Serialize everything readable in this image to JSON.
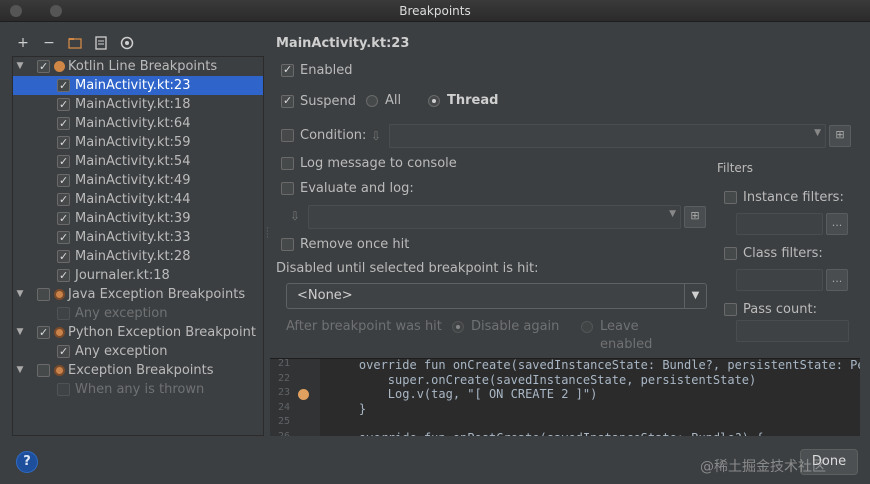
{
  "window": {
    "title": "Breakpoints"
  },
  "toolbar": {
    "add": "+",
    "remove": "−"
  },
  "tree": [
    {
      "id": "kotlin",
      "label": "Kotlin Line Breakpoints",
      "level": 0,
      "arrow": "▼",
      "checked": true,
      "icon": "dot",
      "disabled": false,
      "selected": false
    },
    {
      "id": "k1",
      "label": "MainActivity.kt:23",
      "level": 1,
      "checked": true,
      "selected": true,
      "disabled": false
    },
    {
      "id": "k2",
      "label": "MainActivity.kt:18",
      "level": 1,
      "checked": true,
      "selected": false,
      "disabled": false
    },
    {
      "id": "k3",
      "label": "MainActivity.kt:64",
      "level": 1,
      "checked": true,
      "selected": false,
      "disabled": false
    },
    {
      "id": "k4",
      "label": "MainActivity.kt:59",
      "level": 1,
      "checked": true,
      "selected": false,
      "disabled": false
    },
    {
      "id": "k5",
      "label": "MainActivity.kt:54",
      "level": 1,
      "checked": true,
      "selected": false,
      "disabled": false
    },
    {
      "id": "k6",
      "label": "MainActivity.kt:49",
      "level": 1,
      "checked": true,
      "selected": false,
      "disabled": false
    },
    {
      "id": "k7",
      "label": "MainActivity.kt:44",
      "level": 1,
      "checked": true,
      "selected": false,
      "disabled": false
    },
    {
      "id": "k8",
      "label": "MainActivity.kt:39",
      "level": 1,
      "checked": true,
      "selected": false,
      "disabled": false
    },
    {
      "id": "k9",
      "label": "MainActivity.kt:33",
      "level": 1,
      "checked": true,
      "selected": false,
      "disabled": false
    },
    {
      "id": "k10",
      "label": "MainActivity.kt:28",
      "level": 1,
      "checked": true,
      "selected": false,
      "disabled": false
    },
    {
      "id": "k11",
      "label": "Journaler.kt:18",
      "level": 1,
      "checked": true,
      "selected": false,
      "disabled": false
    },
    {
      "id": "java",
      "label": "Java Exception Breakpoints",
      "level": 0,
      "arrow": "▼",
      "checked": false,
      "icon": "ex",
      "disabled": false,
      "selected": false
    },
    {
      "id": "j1",
      "label": "Any exception",
      "level": 1,
      "checked": false,
      "selected": false,
      "disabled": true
    },
    {
      "id": "python",
      "label": "Python Exception Breakpoint",
      "level": 0,
      "arrow": "▼",
      "checked": true,
      "icon": "ex",
      "disabled": false,
      "selected": false
    },
    {
      "id": "p1",
      "label": "Any exception",
      "level": 1,
      "checked": true,
      "selected": false,
      "disabled": false
    },
    {
      "id": "exc",
      "label": "Exception Breakpoints",
      "level": 0,
      "arrow": "▼",
      "checked": false,
      "icon": "ex",
      "disabled": false,
      "selected": false
    },
    {
      "id": "e1",
      "label": "When any is thrown",
      "level": 1,
      "checked": false,
      "selected": false,
      "disabled": true
    }
  ],
  "detail": {
    "title": "MainActivity.kt:23",
    "enabled_label": "Enabled",
    "suspend_label": "Suspend",
    "all_label": "All",
    "thread_label": "Thread",
    "condition_label": "Condition:",
    "log_message_label": "Log message to console",
    "evaluate_label": "Evaluate and log:",
    "remove_once_label": "Remove once hit",
    "disabled_until_label": "Disabled until selected breakpoint is hit:",
    "none_option": "<None>",
    "after_hit_label": "After breakpoint was hit",
    "disable_again_label": "Disable again",
    "leave_enabled_label": "Leave enabled",
    "filters_label": "Filters",
    "instance_filters_label": "Instance filters:",
    "class_filters_label": "Class filters:",
    "pass_count_label": "Pass count:",
    "ellipsis": "..."
  },
  "code": {
    "lines": [
      {
        "n": "21",
        "text": "    override fun onCreate(savedInstanceState: Bundle?, persistentState: Persis"
      },
      {
        "n": "22",
        "text": "        super.onCreate(savedInstanceState, persistentState)"
      },
      {
        "n": "23",
        "text": "        Log.v(tag, \"[ ON CREATE 2 ]\")"
      },
      {
        "n": "24",
        "text": "    }"
      },
      {
        "n": "25",
        "text": ""
      },
      {
        "n": "26",
        "text": "    override fun onPostCreate(savedInstanceState: Bundle?) {"
      }
    ]
  },
  "footer": {
    "help": "?",
    "done": "Done",
    "watermark": "@稀土掘金技术社区"
  },
  "colors": {
    "selection": "#2f65ca",
    "background": "#3c3f41",
    "editor": "#2b2b2b"
  }
}
